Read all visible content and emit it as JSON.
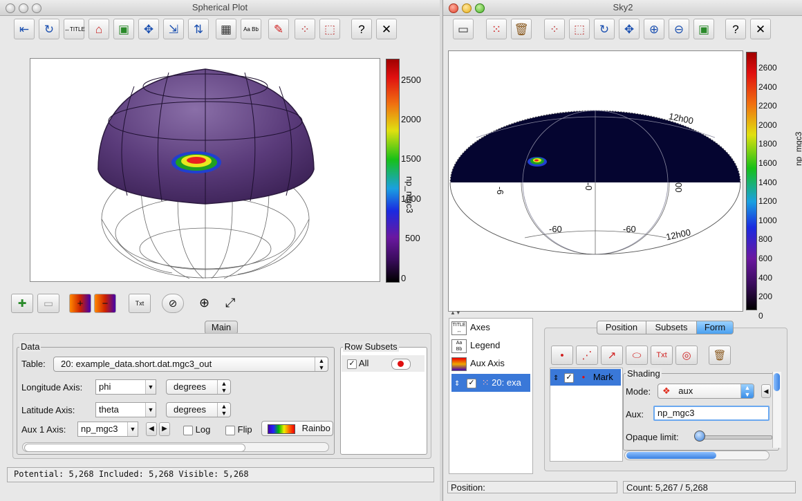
{
  "left_window": {
    "title": "Spherical Plot",
    "toolbar_icons": [
      "frame-icon",
      "replot-icon",
      "axis-limits-icon",
      "pdf-export-icon",
      "image-export-icon",
      "navigate-icon",
      "axis-flip-icon",
      "axis-zoom-icon",
      "grid-icon",
      "axes-labels-icon",
      "red-pencil-icon",
      "subset-blob-icon",
      "subset-polygon-icon",
      "help-icon",
      "close-icon"
    ],
    "colorbar": {
      "label": "np_mgc3",
      "ticks": [
        "2500",
        "2000",
        "1500",
        "1000",
        "500",
        "0"
      ]
    },
    "bottom_tab": "Main",
    "data_group": {
      "title": "Data",
      "table_label": "Table:",
      "table_value": "20: example_data.short.dat.mgc3_out",
      "lon_label": "Longitude Axis:",
      "lon_value": "phi",
      "lon_unit": "degrees",
      "lat_label": "Latitude Axis:",
      "lat_value": "theta",
      "lat_unit": "degrees",
      "aux_label": "Aux 1 Axis:",
      "aux_value": "np_mgc3",
      "log_label": "Log",
      "flip_label": "Flip",
      "shader_label": "Rainbo"
    },
    "subsets_group": {
      "title": "Row Subsets",
      "all_label": "All"
    },
    "status": "Potential: 5,268 Included: 5,268 Visible: 5,268"
  },
  "right_window": {
    "title": "Sky2",
    "colorbar": {
      "label": "np_mgc3",
      "ticks": [
        "2600",
        "2400",
        "2200",
        "2000",
        "1800",
        "1600",
        "1400",
        "1200",
        "1000",
        "800",
        "600",
        "400",
        "200",
        "0"
      ]
    },
    "axis_labels": [
      "12h00",
      "-60",
      "-60",
      "12h00",
      "-6",
      "-0",
      "00"
    ],
    "side_items": [
      "Axes",
      "Legend",
      "Aux Axis"
    ],
    "layer_label": "20: exa",
    "tabs": [
      "Position",
      "Subsets",
      "Form"
    ],
    "active_tab": "Form",
    "mark_label": "Mark",
    "shading_title": "Shading",
    "mode_label": "Mode:",
    "mode_value": "aux",
    "aux_label": "Aux:",
    "aux_value": "np_mgc3",
    "opaque_label": "Opaque limit:",
    "position_label": "Position:",
    "count_label": "Count: 5,267 / 5,268"
  }
}
